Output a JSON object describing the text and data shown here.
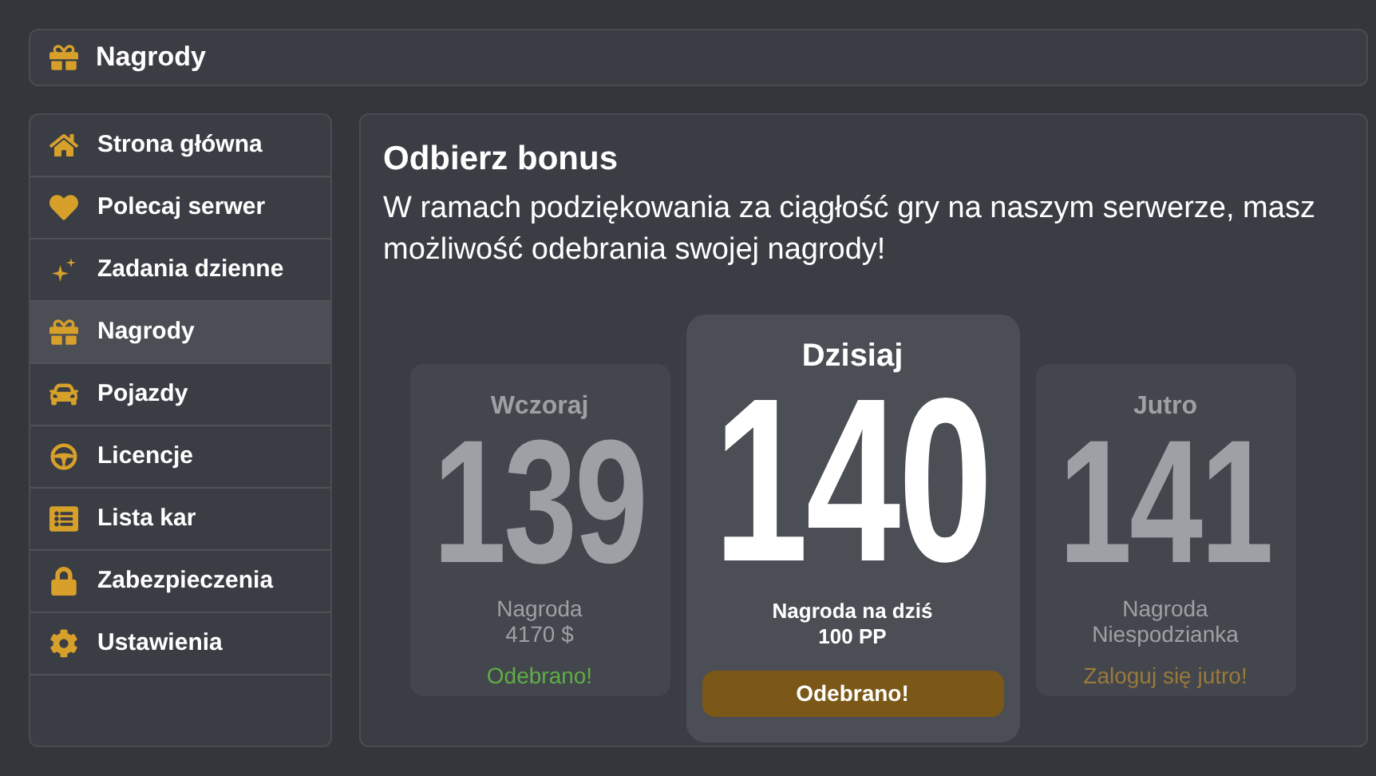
{
  "header": {
    "title": "Nagrody"
  },
  "sidebar": {
    "items": [
      {
        "label": "Strona główna",
        "selected": false
      },
      {
        "label": "Polecaj serwer",
        "selected": false
      },
      {
        "label": "Zadania dzienne",
        "selected": false
      },
      {
        "label": "Nagrody",
        "selected": true
      },
      {
        "label": "Pojazdy",
        "selected": false
      },
      {
        "label": "Licencje",
        "selected": false
      },
      {
        "label": "Lista kar",
        "selected": false
      },
      {
        "label": "Zabezpieczenia",
        "selected": false
      },
      {
        "label": "Ustawienia",
        "selected": false
      }
    ]
  },
  "panel": {
    "title": "Odbierz bonus",
    "description": "W ramach podziękowania za ciągłość gry na naszym serwerze, masz możliwość odebrania swojej nagrody!",
    "cards": [
      {
        "kind": "past",
        "day": "Wczoraj",
        "number": "139",
        "reward": [
          "Nagroda",
          "4170 $"
        ],
        "status": "Odebrano!"
      },
      {
        "kind": "today",
        "day": "Dzisiaj",
        "number": "140",
        "reward": [
          "Nagroda na dziś",
          "100 PP"
        ],
        "status": "Odebrano!"
      },
      {
        "kind": "future",
        "day": "Jutro",
        "number": "141",
        "reward": [
          "Nagroda",
          "Niespodzianka"
        ],
        "status": "Zaloguj się jutro!"
      }
    ]
  }
}
